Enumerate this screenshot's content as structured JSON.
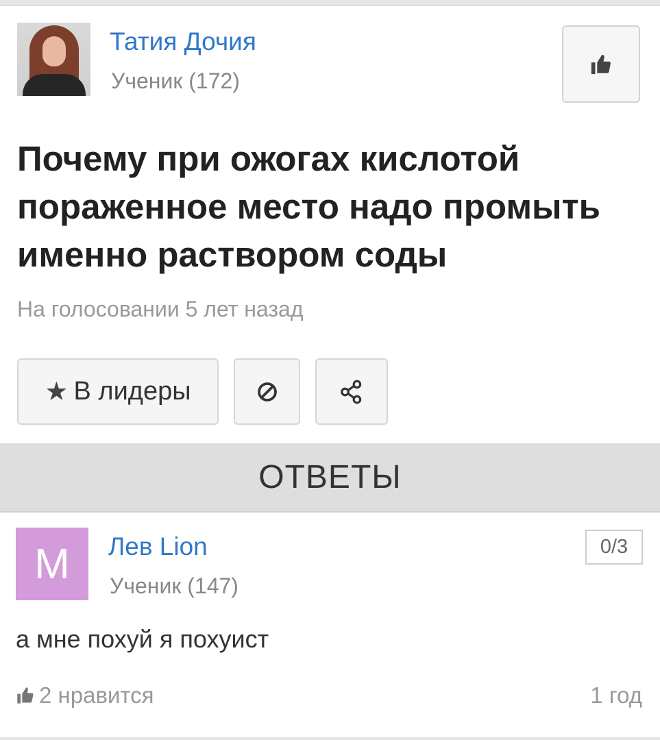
{
  "question": {
    "author_name": "Татия Дочия",
    "author_rank": "Ученик (172)",
    "title": "Почему при ожогах кислотой пораженное место надо промыть именно раствором соды",
    "status": "На голосовании 5 лет назад",
    "actions": {
      "leaders_label": "В лидеры",
      "leaders_icon": "star-icon",
      "block_icon": "block-icon",
      "share_icon": "share-icon",
      "like_icon": "thumbs-up-icon"
    }
  },
  "answers_header": "ОТВЕТЫ",
  "answers": [
    {
      "avatar_letter": "M",
      "avatar_color": "#d39bd9",
      "author_name": "Лев Lion",
      "author_rank": "Ученик (147)",
      "score": "0/3",
      "text": "а мне похуй я похуист",
      "likes": "2 нравится",
      "time": "1 год"
    }
  ],
  "colors": {
    "link": "#2f78c9",
    "muted": "#999999",
    "header_bg": "#dedede"
  }
}
